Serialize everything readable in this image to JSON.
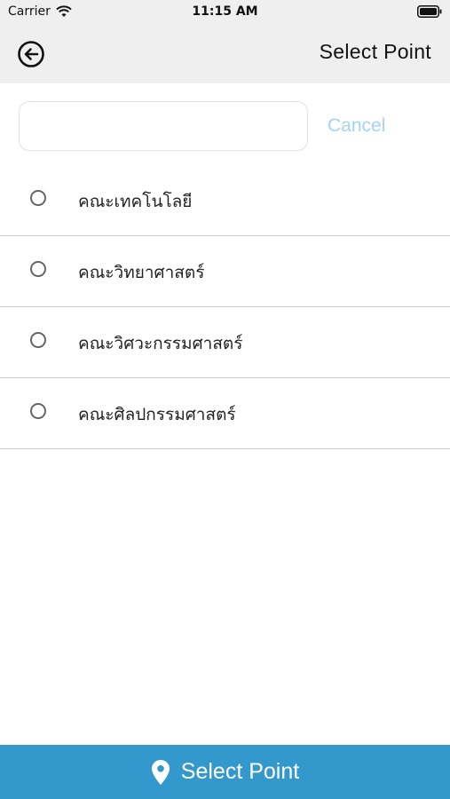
{
  "status_bar": {
    "carrier": "Carrier",
    "time": "11:15 AM"
  },
  "nav": {
    "title": "Select Point"
  },
  "search": {
    "value": "",
    "placeholder": "",
    "cancel_label": "Cancel"
  },
  "list": {
    "items": [
      {
        "label": "คณะเทคโนโลยี",
        "selected": false
      },
      {
        "label": "คณะวิทยาศาสตร์",
        "selected": false
      },
      {
        "label": "คณะวิศวะกรรมศาสตร์",
        "selected": false
      },
      {
        "label": "คณะศิลปกรรมศาสตร์",
        "selected": false
      }
    ]
  },
  "footer": {
    "button_label": "Select Point",
    "button_icon": "map-pin-icon"
  },
  "colors": {
    "accent": "#3399cc",
    "cancel": "#a4d4f4",
    "header_bg": "#efefef"
  }
}
